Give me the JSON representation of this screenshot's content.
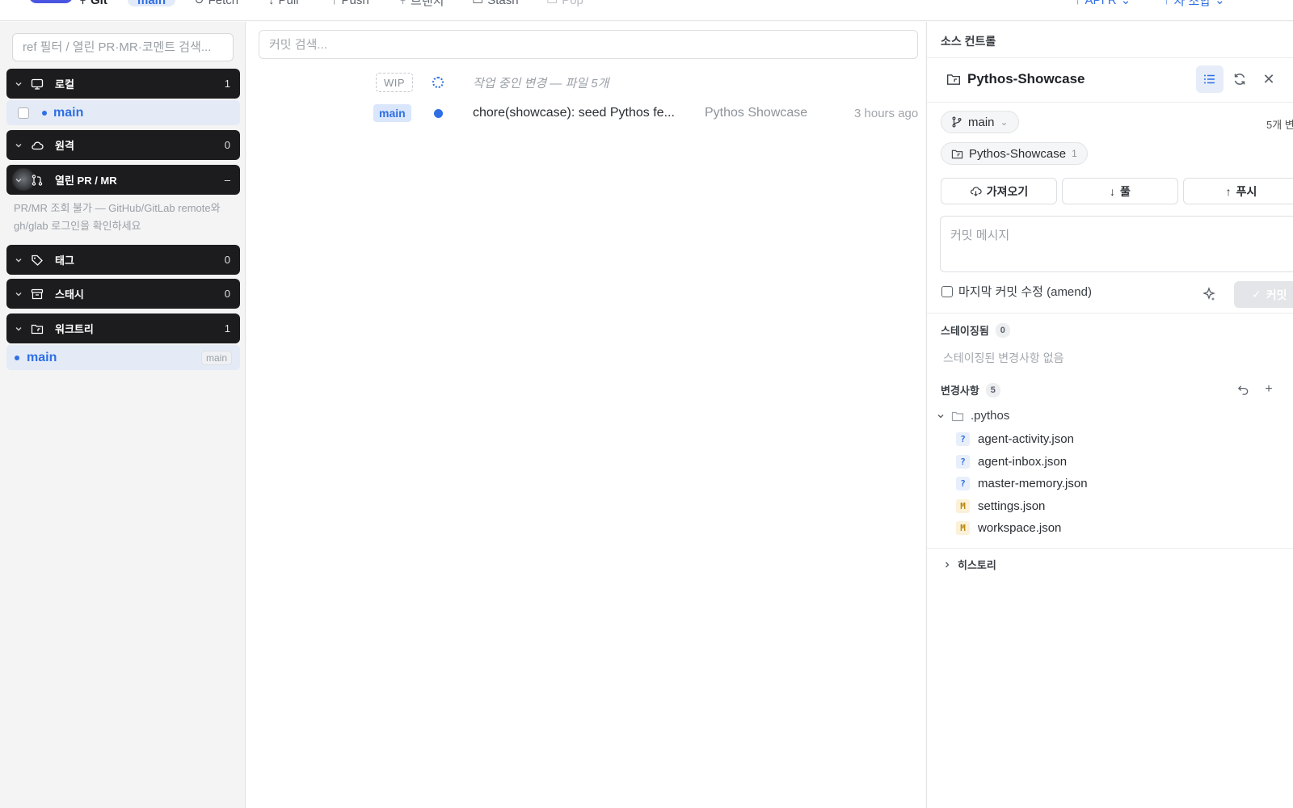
{
  "toolbar": {
    "app_label": "Git",
    "branch_pill": "main",
    "fetch_label": "Fetch",
    "pull_label": "Pull",
    "push_label": "Push",
    "branch_label": "브랜치",
    "stash_label": "Stash",
    "pop_label": "Pop",
    "api_label": "API R",
    "right_label": "자 조합"
  },
  "sidebar": {
    "filter_placeholder": "ref 필터 / 열린 PR·MR·코멘트 검색...",
    "local": {
      "label": "로컬",
      "count": "1",
      "branch": "main"
    },
    "remote": {
      "label": "원격",
      "count": "0"
    },
    "pr": {
      "label": "열린 PR / MR",
      "count": "–",
      "note": "PR/MR 조회 불가 — GitHub/GitLab remote와 gh/glab 로그인을 확인하세요"
    },
    "tags": {
      "label": "태그",
      "count": "0"
    },
    "stash": {
      "label": "스태시",
      "count": "0"
    },
    "worktree": {
      "label": "워크트리",
      "count": "1",
      "item": "main",
      "item_tag": "main"
    }
  },
  "graph": {
    "search_placeholder": "커밋 검색...",
    "wip": {
      "badge": "WIP",
      "text": "작업 중인 변경 — 파일 5개"
    },
    "commits": [
      {
        "branch": "main",
        "message": "chore(showcase): seed Pythos fe...",
        "author": "Pythos Showcase",
        "time": "3 hours ago"
      }
    ]
  },
  "panel": {
    "title": "소스 컨트롤",
    "repo_name": "Pythos-Showcase",
    "branch_chip": "main",
    "changes_note": "5개 변",
    "worktree_chip": {
      "label": "Pythos-Showcase",
      "count": "1"
    },
    "fetch_button": "가져오기",
    "pull_button": "풀",
    "push_button": "푸시",
    "commit_placeholder": "커밋 메시지",
    "amend_label": "마지막 커밋 수정 (amend)",
    "commit_button": "커밋",
    "staged": {
      "label": "스테이징됨",
      "count": "0",
      "empty": "스테이징된 변경사항 없음"
    },
    "changes": {
      "label": "변경사항",
      "count": "5",
      "folder": ".pythos",
      "files": [
        {
          "status": "?",
          "kind": "untracked",
          "name": "agent-activity.json"
        },
        {
          "status": "?",
          "kind": "untracked",
          "name": "agent-inbox.json"
        },
        {
          "status": "?",
          "kind": "untracked",
          "name": "master-memory.json"
        },
        {
          "status": "M",
          "kind": "modified",
          "name": "settings.json"
        },
        {
          "status": "M",
          "kind": "modified",
          "name": "workspace.json"
        }
      ]
    },
    "history_label": "히스토리"
  }
}
